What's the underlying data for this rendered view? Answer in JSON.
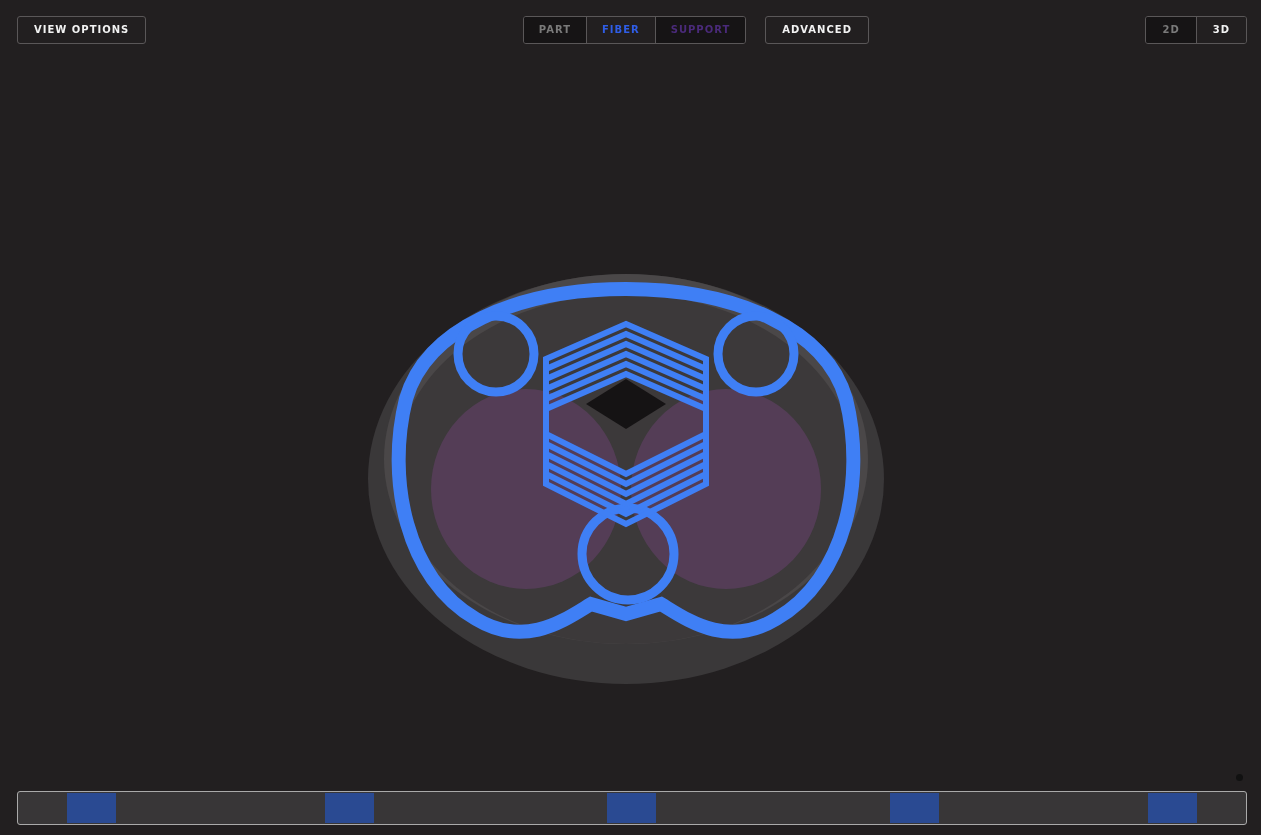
{
  "toolbar": {
    "view_options": "VIEW OPTIONS",
    "layers": [
      {
        "label": "PART",
        "selected": false,
        "color": "#7a7a7a"
      },
      {
        "label": "FIBER",
        "selected": true,
        "color": "#2f5de6"
      },
      {
        "label": "SUPPORT",
        "selected": false,
        "color": "#4a2a7a"
      }
    ],
    "advanced": "ADVANCED",
    "view_modes": [
      {
        "label": "2D",
        "selected": false
      },
      {
        "label": "3D",
        "selected": true
      }
    ]
  }
}
